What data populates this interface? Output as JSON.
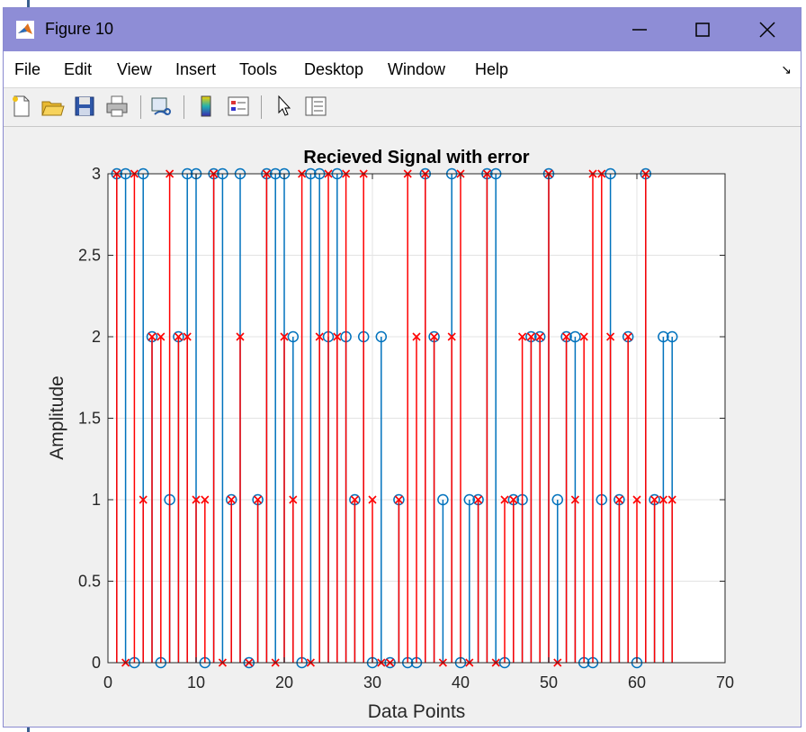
{
  "window": {
    "title": "Figure 10"
  },
  "menu": {
    "items": [
      "File",
      "Edit",
      "View",
      "Insert",
      "Tools",
      "Desktop",
      "Window",
      "Help"
    ]
  },
  "toolbar": {
    "icons": [
      "new-figure-icon",
      "open-file-icon",
      "save-icon",
      "print-icon",
      "link-plot-icon",
      "colorbar-icon",
      "legend-icon",
      "edit-plot-icon",
      "property-inspector-icon"
    ]
  },
  "colors": {
    "titlebar": "#8e8dd6",
    "tx_series": "#0072bd",
    "rx_series": "#ff0000"
  },
  "chart_data": {
    "type": "stem",
    "title": "Recieved Signal with error",
    "xlabel": "Data Points",
    "ylabel": "Amplitude",
    "xlim": [
      0,
      70
    ],
    "ylim": [
      0,
      3
    ],
    "xticks": [
      "0",
      "10",
      "20",
      "30",
      "40",
      "50",
      "60",
      "70"
    ],
    "yticks": [
      "0",
      "0.5",
      "1",
      "1.5",
      "2",
      "2.5",
      "3"
    ],
    "grid": true,
    "series": [
      {
        "marker": "circle",
        "color": "#0072bd",
        "x": [
          1,
          2,
          3,
          4,
          5,
          6,
          7,
          8,
          9,
          10,
          11,
          12,
          13,
          14,
          15,
          16,
          17,
          18,
          19,
          20,
          21,
          22,
          23,
          24,
          25,
          26,
          27,
          28,
          29,
          30,
          31,
          32,
          33,
          34,
          35,
          36,
          37,
          38,
          39,
          40,
          41,
          42,
          43,
          44,
          45,
          46,
          47,
          48,
          49,
          50,
          51,
          52,
          53,
          54,
          55,
          56,
          57,
          58,
          59,
          60,
          61,
          62,
          63,
          64
        ],
        "values": [
          3,
          3,
          0,
          3,
          2,
          0,
          1,
          2,
          3,
          3,
          0,
          3,
          3,
          1,
          3,
          0,
          1,
          3,
          3,
          3,
          2,
          0,
          3,
          3,
          2,
          3,
          2,
          1,
          2,
          0,
          2,
          0,
          1,
          0,
          0,
          3,
          2,
          1,
          3,
          0,
          1,
          1,
          3,
          3,
          0,
          1,
          1,
          2,
          2,
          3,
          1,
          2,
          2,
          0,
          0,
          1,
          3,
          1,
          2,
          0,
          3,
          1,
          2,
          2
        ]
      },
      {
        "marker": "x",
        "color": "#ff0000",
        "x": [
          1,
          2,
          3,
          4,
          5,
          6,
          7,
          8,
          9,
          10,
          11,
          12,
          13,
          14,
          15,
          16,
          17,
          18,
          19,
          20,
          21,
          22,
          23,
          24,
          25,
          26,
          27,
          28,
          29,
          30,
          31,
          32,
          33,
          34,
          35,
          36,
          37,
          38,
          39,
          40,
          41,
          42,
          43,
          44,
          45,
          46,
          47,
          48,
          49,
          50,
          51,
          52,
          53,
          54,
          55,
          56,
          57,
          58,
          59,
          60,
          61,
          62,
          63,
          64
        ],
        "values": [
          3,
          0,
          3,
          1,
          2,
          2,
          3,
          2,
          2,
          1,
          1,
          3,
          0,
          1,
          2,
          0,
          1,
          3,
          0,
          2,
          1,
          3,
          0,
          2,
          3,
          2,
          3,
          1,
          3,
          1,
          0,
          0,
          1,
          3,
          2,
          3,
          2,
          0,
          2,
          3,
          0,
          1,
          3,
          0,
          1,
          1,
          2,
          2,
          2,
          3,
          0,
          2,
          1,
          2,
          3,
          3,
          2,
          1,
          2,
          1,
          3,
          1,
          1,
          1
        ]
      }
    ]
  }
}
